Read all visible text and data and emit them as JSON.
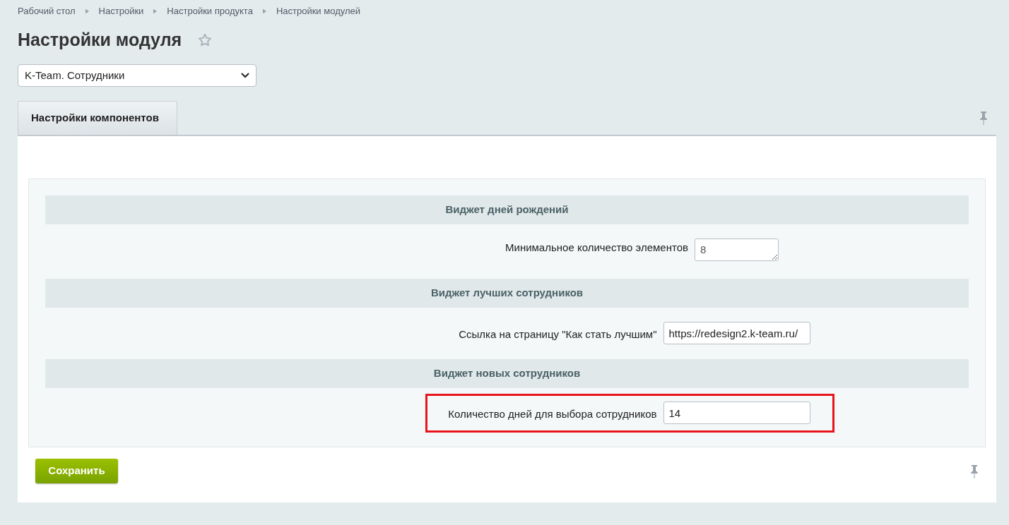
{
  "breadcrumbs": [
    "Рабочий стол",
    "Настройки",
    "Настройки продукта",
    "Настройки модулей"
  ],
  "title": "Настройки модуля",
  "module_select": {
    "value": "K-Team. Сотрудники"
  },
  "tabs": [
    {
      "label": "Настройки компонентов",
      "selected": true
    }
  ],
  "sections": [
    {
      "title": "Виджет дней рождений",
      "rows": [
        {
          "label": "Минимальное количество элементов",
          "kind": "textarea",
          "value": "8",
          "highlighted": false
        }
      ]
    },
    {
      "title": "Виджет лучших сотрудников",
      "rows": [
        {
          "label": "Ссылка на страницу \"Как стать лучшим\"",
          "kind": "text",
          "value": "https://redesign2.k-team.ru/",
          "highlighted": false
        }
      ]
    },
    {
      "title": "Виджет новых сотрудников",
      "rows": [
        {
          "label": "Количество дней для выбора сотрудников",
          "kind": "text",
          "value": "14",
          "highlighted": true
        }
      ]
    }
  ],
  "buttons": [
    "Сохранить"
  ]
}
